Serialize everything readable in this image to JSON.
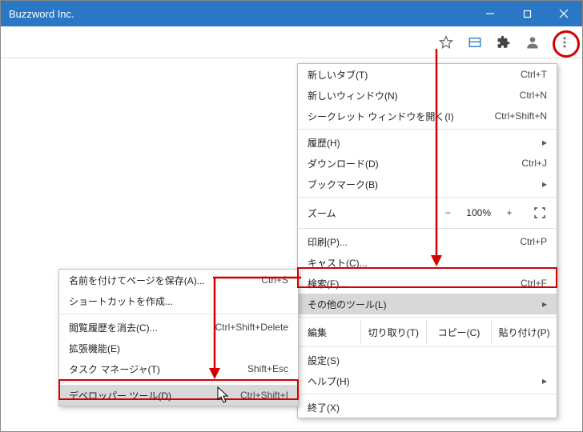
{
  "window": {
    "title": "Buzzword Inc."
  },
  "menu_main": {
    "new_tab": {
      "label": "新しいタブ(T)",
      "shortcut": "Ctrl+T"
    },
    "new_window": {
      "label": "新しいウィンドウ(N)",
      "shortcut": "Ctrl+N"
    },
    "incognito": {
      "label": "シークレット ウィンドウを開く(I)",
      "shortcut": "Ctrl+Shift+N"
    },
    "history": {
      "label": "履歴(H)"
    },
    "downloads": {
      "label": "ダウンロード(D)",
      "shortcut": "Ctrl+J"
    },
    "bookmarks": {
      "label": "ブックマーク(B)"
    },
    "zoom_label": "ズーム",
    "zoom_minus": "−",
    "zoom_value": "100%",
    "zoom_plus": "+",
    "print": {
      "label": "印刷(P)...",
      "shortcut": "Ctrl+P"
    },
    "cast": {
      "label": "キャスト(C)..."
    },
    "find": {
      "label": "検索(F)...",
      "shortcut": "Ctrl+F"
    },
    "more_tools": {
      "label": "その他のツール(L)"
    },
    "edit_label": "編集",
    "cut": "切り取り(T)",
    "copy": "コピー(C)",
    "paste": "貼り付け(P)",
    "settings": {
      "label": "設定(S)"
    },
    "help": {
      "label": "ヘルプ(H)"
    },
    "exit": {
      "label": "終了(X)"
    }
  },
  "menu_sub": {
    "save_as": {
      "label": "名前を付けてページを保存(A)...",
      "shortcut": "Ctrl+S"
    },
    "create_shortcut": {
      "label": "ショートカットを作成..."
    },
    "clear_browsing": {
      "label": "閲覧履歴を消去(C)...",
      "shortcut": "Ctrl+Shift+Delete"
    },
    "extensions": {
      "label": "拡張機能(E)"
    },
    "task_manager": {
      "label": "タスク マネージャ(T)",
      "shortcut": "Shift+Esc"
    },
    "dev_tools": {
      "label": "デベロッパー ツール(D)",
      "shortcut": "Ctrl+Shift+I"
    }
  }
}
